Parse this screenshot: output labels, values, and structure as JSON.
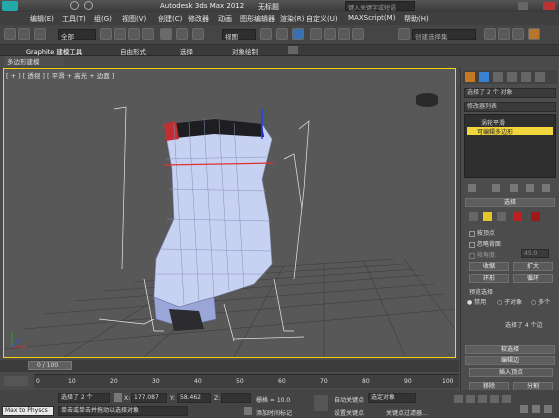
{
  "app": {
    "title": "Autodesk 3ds Max  2012",
    "doc_title": "无标题",
    "search_placeholder": "键入关键字或短语"
  },
  "menu": [
    "编辑(E)",
    "工具(T)",
    "组(G)",
    "视图(V)",
    "创建(C)",
    "修改器",
    "动画",
    "图形编辑器",
    "渲染(R)",
    "自定义(U)",
    "MAXScript(M)",
    "帮助(H)"
  ],
  "toolbar": {
    "filter_value": "全部",
    "view_value": "视图",
    "named_selection_placeholder": "创建选择集"
  },
  "ribbon": {
    "tabs": [
      "Graphite 建模工具",
      "自由形式",
      "选择",
      "对象绘制"
    ],
    "subtab": "多边形建模"
  },
  "viewport": {
    "label": "[ + ] [ 透视 ] [ 平滑 + 高光 + 边面 ]"
  },
  "command_panel": {
    "selection_info": "选择了 2 个 对象",
    "modifier_list": "修改器列表",
    "stack_items": [
      "涡轮平滑",
      "可编辑多边形"
    ],
    "rollout_select": "选择",
    "checkboxes": [
      "按顶点",
      "忽略背面",
      "按角度:"
    ],
    "angle_value": "45.0",
    "buttons_row1": [
      "收缩",
      "扩大"
    ],
    "buttons_row2": [
      "环形",
      "循环"
    ],
    "preview_label": "预览选择",
    "preview_options": [
      "禁用",
      "子对象",
      "多个"
    ],
    "selected_count": "选择了 4 个边",
    "soft_select": "软选择",
    "edit_edges": "编辑边",
    "insert_vertex": "插入顶点",
    "remove": "移除",
    "split": "分割"
  },
  "timeline": {
    "frame": "0 / 100",
    "ticks": [
      "0",
      "10",
      "20",
      "30",
      "40",
      "50",
      "60",
      "70",
      "80",
      "90",
      "100"
    ]
  },
  "status": {
    "script_label": "Max to Physcs",
    "selected": "选择了 2 个",
    "prompt": "单击或单击并拖动以选择对象",
    "x_label": "X:",
    "x_value": "177.087",
    "y_label": "Y:",
    "y_value": "58.462",
    "z_label": "Z:",
    "grid": "栅格 = 10.0",
    "add_tag": "添加时间标记",
    "auto_key": "自动关键点",
    "set_key": "设置关键点",
    "selected_obj": "选定对象",
    "key_filter": "关键点过滤器..."
  },
  "colors": {
    "accent": "#ffd200",
    "active_viewport_border": "#ffd200"
  }
}
